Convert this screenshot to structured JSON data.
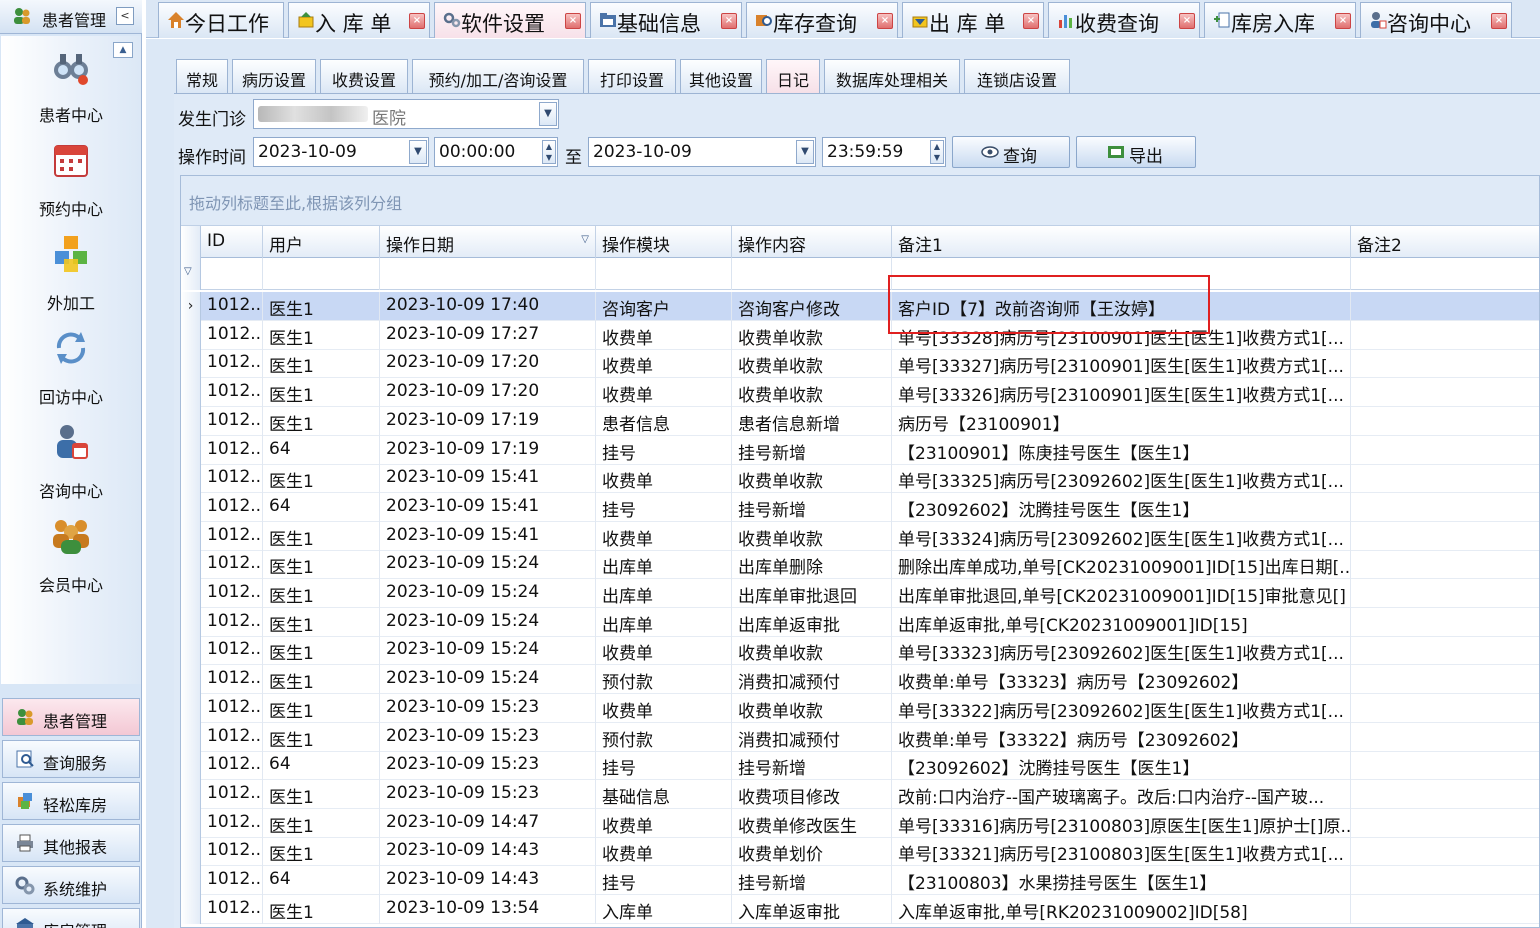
{
  "sidebar": {
    "header_title": "患者管理",
    "collapse_symbol": "<",
    "nav_items": [
      {
        "label": "患者中心",
        "icon": "binoculars-icon"
      },
      {
        "label": "预约中心",
        "icon": "calendar-icon"
      },
      {
        "label": "外加工",
        "icon": "cubes-icon"
      },
      {
        "label": "回访中心",
        "icon": "refresh-icon"
      },
      {
        "label": "咨询中心",
        "icon": "consult-icon"
      },
      {
        "label": "会员中心",
        "icon": "members-icon"
      }
    ],
    "categories": [
      {
        "label": "患者管理",
        "icon": "patients-icon",
        "active": true
      },
      {
        "label": "查询服务",
        "icon": "search-icon",
        "active": false
      },
      {
        "label": "轻松库房",
        "icon": "warehouse-icon",
        "active": false
      },
      {
        "label": "其他报表",
        "icon": "printer-icon",
        "active": false
      },
      {
        "label": "系统维护",
        "icon": "gears-icon",
        "active": false
      },
      {
        "label": "库房管理",
        "icon": "store-icon",
        "active": false
      }
    ]
  },
  "top_tabs": [
    {
      "label": "今日工作",
      "active": false,
      "closable": false
    },
    {
      "label": "入 库 单",
      "active": false,
      "closable": true
    },
    {
      "label": "软件设置",
      "active": true,
      "closable": true
    },
    {
      "label": "基础信息",
      "active": false,
      "closable": true
    },
    {
      "label": "库存查询",
      "active": false,
      "closable": true
    },
    {
      "label": "出 库 单",
      "active": false,
      "closable": true
    },
    {
      "label": "收费查询",
      "active": false,
      "closable": true
    },
    {
      "label": "库房入库",
      "active": false,
      "closable": true
    },
    {
      "label": "咨询中心",
      "active": false,
      "closable": true
    }
  ],
  "sub_tabs": [
    {
      "label": "常规",
      "active": false
    },
    {
      "label": "病历设置",
      "active": false
    },
    {
      "label": "收费设置",
      "active": false
    },
    {
      "label": "预约/加工/咨询设置",
      "active": false
    },
    {
      "label": "打印设置",
      "active": false
    },
    {
      "label": "其他设置",
      "active": false
    },
    {
      "label": "日记",
      "active": true
    },
    {
      "label": "数据库处理相关",
      "active": false
    },
    {
      "label": "连锁店设置",
      "active": false
    }
  ],
  "filters": {
    "clinic_label": "发生门诊",
    "clinic_value_suffix": "医院",
    "time_label": "操作时间",
    "start_date": "2023-10-09",
    "start_time": "00:00:00",
    "to_label": "至",
    "end_date": "2023-10-09",
    "end_time": "23:59:59",
    "query_label": "查询",
    "export_label": "导出"
  },
  "grid": {
    "group_hint": "拖动列标题至此,根据该列分组",
    "columns": [
      "ID",
      "用户",
      "操作日期",
      "操作模块",
      "操作内容",
      "备注1",
      "备注2"
    ],
    "sorted_column": "操作日期",
    "selected_row": 0,
    "rows": [
      [
        "1012...",
        "医生1",
        "2023-10-09 17:40",
        "咨询客户",
        "咨询客户修改",
        "客户ID【7】改前咨询师【王汝婷】",
        ""
      ],
      [
        "1012...",
        "医生1",
        "2023-10-09 17:27",
        "收费单",
        "收费单收款",
        "单号[33328]病历号[23100901]医生[医生1]收费方式1[...",
        ""
      ],
      [
        "1012...",
        "医生1",
        "2023-10-09 17:20",
        "收费单",
        "收费单收款",
        "单号[33327]病历号[23100901]医生[医生1]收费方式1[...",
        ""
      ],
      [
        "1012...",
        "医生1",
        "2023-10-09 17:20",
        "收费单",
        "收费单收款",
        "单号[33326]病历号[23100901]医生[医生1]收费方式1[...",
        ""
      ],
      [
        "1012...",
        "医生1",
        "2023-10-09 17:19",
        "患者信息",
        "患者信息新增",
        "病历号【23100901】",
        ""
      ],
      [
        "1012...",
        "64",
        "2023-10-09 17:19",
        "挂号",
        "挂号新增",
        "【23100901】陈庚挂号医生【医生1】",
        ""
      ],
      [
        "1012...",
        "医生1",
        "2023-10-09 15:41",
        "收费单",
        "收费单收款",
        "单号[33325]病历号[23092602]医生[医生1]收费方式1[...",
        ""
      ],
      [
        "1012...",
        "64",
        "2023-10-09 15:41",
        "挂号",
        "挂号新增",
        "【23092602】沈腾挂号医生【医生1】",
        ""
      ],
      [
        "1012...",
        "医生1",
        "2023-10-09 15:41",
        "收费单",
        "收费单收款",
        "单号[33324]病历号[23092602]医生[医生1]收费方式1[...",
        ""
      ],
      [
        "1012...",
        "医生1",
        "2023-10-09 15:24",
        "出库单",
        "出库单删除",
        "删除出库单成功,单号[CK20231009001]ID[15]出库日期[...",
        ""
      ],
      [
        "1012...",
        "医生1",
        "2023-10-09 15:24",
        "出库单",
        "出库单审批退回",
        "出库单审批退回,单号[CK20231009001]ID[15]审批意见[]",
        ""
      ],
      [
        "1012...",
        "医生1",
        "2023-10-09 15:24",
        "出库单",
        "出库单返审批",
        "出库单返审批,单号[CK20231009001]ID[15]",
        ""
      ],
      [
        "1012...",
        "医生1",
        "2023-10-09 15:24",
        "收费单",
        "收费单收款",
        "单号[33323]病历号[23092602]医生[医生1]收费方式1[...",
        ""
      ],
      [
        "1012...",
        "医生1",
        "2023-10-09 15:24",
        "预付款",
        "消费扣减预付",
        "收费单:单号【33323】病历号【23092602】",
        ""
      ],
      [
        "1012...",
        "医生1",
        "2023-10-09 15:23",
        "收费单",
        "收费单收款",
        "单号[33322]病历号[23092602]医生[医生1]收费方式1[...",
        ""
      ],
      [
        "1012...",
        "医生1",
        "2023-10-09 15:23",
        "预付款",
        "消费扣减预付",
        "收费单:单号【33322】病历号【23092602】",
        ""
      ],
      [
        "1012...",
        "64",
        "2023-10-09 15:23",
        "挂号",
        "挂号新增",
        "【23092602】沈腾挂号医生【医生1】",
        ""
      ],
      [
        "1012...",
        "医生1",
        "2023-10-09 15:23",
        "基础信息",
        "收费项目修改",
        "改前:口内治疗--国产玻璃离子。改后:口内治疗--国产玻...",
        ""
      ],
      [
        "1012...",
        "医生1",
        "2023-10-09 14:47",
        "收费单",
        "收费单修改医生",
        "单号[33316]病历号[23100803]原医生[医生1]原护士[]原...",
        ""
      ],
      [
        "1012...",
        "医生1",
        "2023-10-09 14:43",
        "收费单",
        "收费单划价",
        "单号[33321]病历号[23100803]医生[医生1]收费方式1[...",
        ""
      ],
      [
        "1012...",
        "64",
        "2023-10-09 14:43",
        "挂号",
        "挂号新增",
        "【23100803】水果捞挂号医生【医生1】",
        ""
      ],
      [
        "1012...",
        "医生1",
        "2023-10-09 13:54",
        "入库单",
        "入库单返审批",
        "入库单返审批,单号[RK20231009002]ID[58]",
        ""
      ]
    ]
  },
  "colors": {
    "highlight_box": "#e02020",
    "selected_row": "#c8d8f4",
    "panel_bg": "#dce8f6"
  }
}
